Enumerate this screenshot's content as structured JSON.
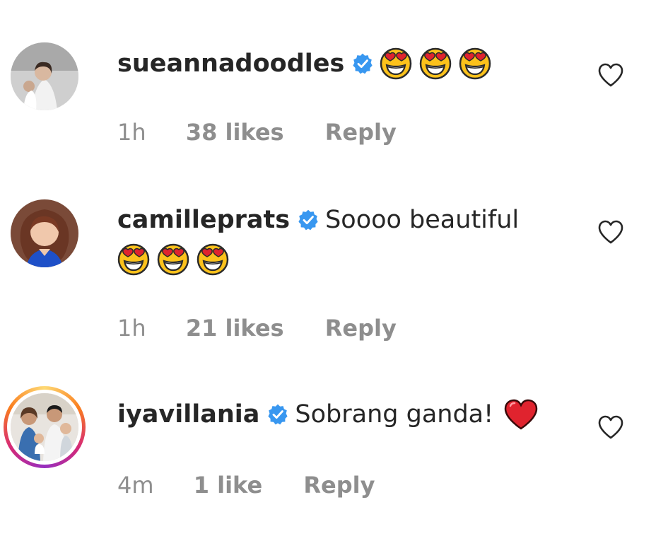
{
  "comments": [
    {
      "username": "sueannadoodles",
      "verified": true,
      "text": "",
      "time": "1h",
      "likes": "38 likes",
      "reply_label": "Reply",
      "emojis": [
        "heart-eyes-emoji",
        "heart-eyes-emoji",
        "heart-eyes-emoji"
      ]
    },
    {
      "username": "camilleprats",
      "verified": true,
      "text": "Soooo beautiful",
      "time": "1h",
      "likes": "21 likes",
      "reply_label": "Reply",
      "emojis": [
        "heart-eyes-emoji",
        "heart-eyes-emoji",
        "heart-eyes-emoji"
      ]
    },
    {
      "username": "iyavillania",
      "verified": true,
      "text": "Sobrang ganda!",
      "time": "4m",
      "likes": "1 like",
      "reply_label": "Reply",
      "emojis": [
        "red-heart-emoji"
      ]
    }
  ],
  "colors": {
    "verified": "#3897f0",
    "meta_text": "#8e8e8e",
    "primary_text": "#262626"
  },
  "icons": {
    "verified": "verified-badge-icon",
    "like": "heart-outline-icon"
  }
}
